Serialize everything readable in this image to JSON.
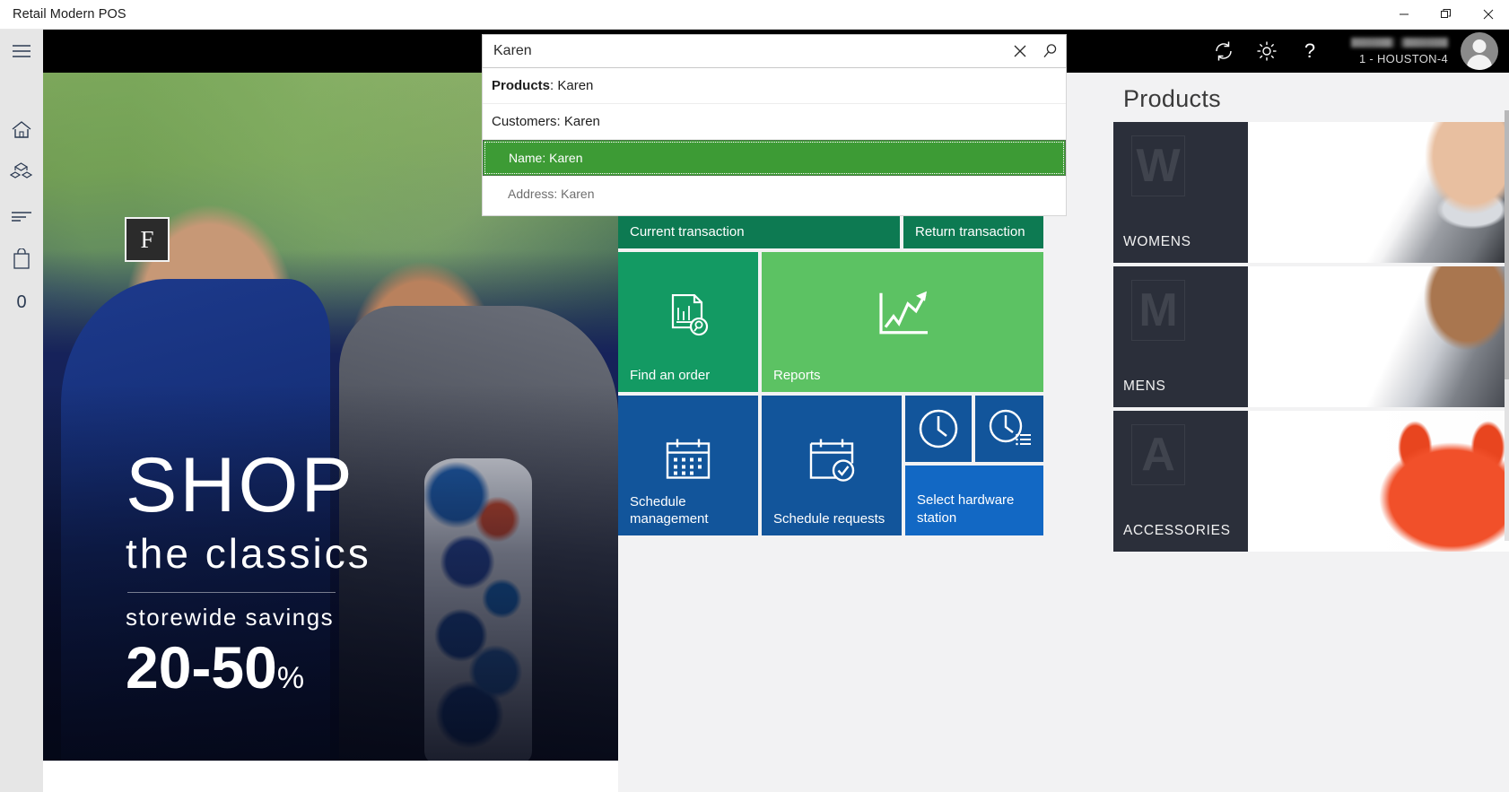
{
  "window": {
    "title": "Retail Modern POS",
    "minimize_label": "Minimize",
    "restore_label": "Restore",
    "close_label": "Close"
  },
  "rail": {
    "items": [
      {
        "name": "menu-icon",
        "label": "Menu"
      },
      {
        "name": "home-icon",
        "label": "Home"
      },
      {
        "name": "products-icon",
        "label": "Products"
      },
      {
        "name": "list-icon",
        "label": "Tasks"
      },
      {
        "name": "bag-icon",
        "label": "Cart"
      }
    ],
    "cart_count": "0"
  },
  "header": {
    "sync_icon": "sync-icon",
    "settings_icon": "gear-icon",
    "help_icon": "help-icon",
    "store": "1 - HOUSTON-4",
    "avatar_icon": "avatar"
  },
  "search": {
    "value": "Karen",
    "placeholder": "Search",
    "clear_icon": "close-icon",
    "submit_icon": "search-icon",
    "suggestions": [
      {
        "label": "Products",
        "value": "Karen",
        "bold": true,
        "indent": false,
        "selected": false
      },
      {
        "label": "Customers",
        "value": "Karen",
        "bold": false,
        "indent": false,
        "selected": false
      },
      {
        "label": "Name",
        "value": "Karen",
        "bold": false,
        "indent": true,
        "selected": true
      },
      {
        "label": "Address",
        "value": "Karen",
        "bold": false,
        "indent": true,
        "selected": false
      }
    ],
    "suggestion_text": {
      "products": "Products: Karen",
      "products_label": "Products",
      "products_rest": ": Karen",
      "customers": "Customers: Karen",
      "name": "Name: Karen",
      "address": "Address: Karen"
    }
  },
  "banner": {
    "brand_letter": "F",
    "headline": "SHOP",
    "subhead": "the classics",
    "promo_line": "storewide  savings",
    "discount": "20-50",
    "discount_unit": "%"
  },
  "tiles": [
    {
      "name": "current-transaction",
      "label": "Current transaction",
      "color": "#0d7a52",
      "icon": ""
    },
    {
      "name": "return-transaction",
      "label": "Return transaction",
      "color": "#0d7a52",
      "icon": ""
    },
    {
      "name": "find-an-order",
      "label": "Find an order",
      "color": "#139a63",
      "icon": "find-order-icon"
    },
    {
      "name": "reports",
      "label": "Reports",
      "color": "#5cc263",
      "icon": "chart-up-icon"
    },
    {
      "name": "schedule-management",
      "label": "Schedule management",
      "color": "#12559b",
      "icon": "calendar-grid-icon"
    },
    {
      "name": "schedule-requests",
      "label": "Schedule requests",
      "color": "#12559b",
      "icon": "calendar-check-icon"
    },
    {
      "name": "clock-in-out",
      "label": "",
      "color": "#12559b",
      "icon": "clock-icon"
    },
    {
      "name": "time-entries",
      "label": "",
      "color": "#12559b",
      "icon": "clock-list-icon"
    },
    {
      "name": "select-hardware-station",
      "label": "Select hardware station",
      "color": "#1268c4",
      "icon": ""
    }
  ],
  "products": {
    "title": "Products",
    "categories": [
      {
        "name": "womens",
        "letter": "W",
        "label": "WOMENS"
      },
      {
        "name": "mens",
        "letter": "M",
        "label": "MENS"
      },
      {
        "name": "accessories",
        "letter": "A",
        "label": "ACCESSORIES"
      }
    ]
  },
  "colors": {
    "header_bg": "#000000",
    "rail_bg": "#e6e6e6",
    "canvas_bg": "#f2f2f3",
    "tile_green_dark": "#0d7a52",
    "tile_green_mid": "#139a63",
    "tile_green_light": "#5cc263",
    "tile_blue": "#12559b",
    "tile_blue_bright": "#1268c4",
    "suggest_selected": "#3d9b35",
    "category_badge": "#2b2f3a"
  }
}
